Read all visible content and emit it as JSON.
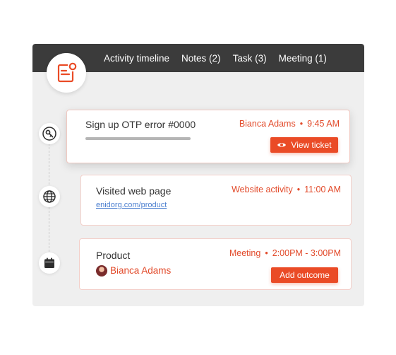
{
  "tabs": [
    {
      "label": "Activity timeline"
    },
    {
      "label": "Notes (2)"
    },
    {
      "label": "Task (3)"
    },
    {
      "label": "Meeting (1)"
    }
  ],
  "logo_icon": "note-alert-icon",
  "colors": {
    "accent": "#ea4b26",
    "topbar": "#3b3b3b",
    "panel": "#efefef",
    "link": "#4a7ecf"
  },
  "timeline": [
    {
      "icon": "key-icon",
      "title": "Sign up OTP error #0000",
      "who": "Bianca Adams",
      "separator": "•",
      "time": "9:45 AM",
      "progress_fraction": 0.62,
      "button": {
        "label": "View ticket",
        "icon": "eye-icon"
      }
    },
    {
      "icon": "globe-icon",
      "title": "Visited web page",
      "who": "Website activity",
      "separator": "•",
      "time": "11:00 AM",
      "link": "enidorg.com/product"
    },
    {
      "icon": "calendar-icon",
      "title": "Product",
      "who": "Meeting",
      "separator": "•",
      "time": "2:00PM - 3:00PM",
      "person": "Bianca Adams",
      "button": {
        "label": "Add outcome"
      }
    }
  ]
}
